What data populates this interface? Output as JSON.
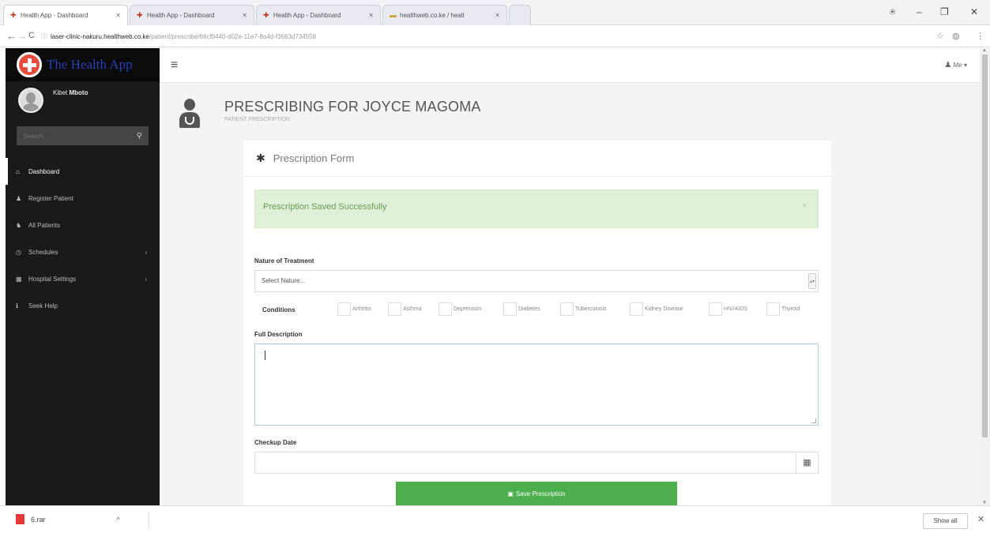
{
  "browser": {
    "tabs": [
      {
        "label": "Health App - Dashboard"
      },
      {
        "label": "Health App - Dashboard"
      },
      {
        "label": "Health App - Dashboard"
      },
      {
        "label": "healthweb.co.ke / healt"
      }
    ],
    "url_host": "laser-clinic-nakuru.healthweb.co.ke",
    "url_path": "/patient/prescribe/66cf8440-d02e-11e7-8a4d-f3663d734558",
    "nav": {
      "back": "←",
      "forward": "→",
      "reload": "C"
    },
    "window_controls": {
      "minimize": "–",
      "maximize": "❐",
      "close": "✕"
    }
  },
  "sidebar": {
    "brand": "The Health App",
    "user_first": "Kibet",
    "user_last": "Mboto",
    "search_placeholder": "Search...",
    "items": [
      {
        "label": "Dashboard",
        "icon": "home-icon",
        "glyph": "⌂"
      },
      {
        "label": "Register Patient",
        "icon": "user-icon",
        "glyph": "♟"
      },
      {
        "label": "All Patients",
        "icon": "users-icon",
        "glyph": "♞"
      },
      {
        "label": "Schedules",
        "icon": "clock-icon",
        "glyph": "◷"
      },
      {
        "label": "Hospital Settings",
        "icon": "building-icon",
        "glyph": "▦"
      },
      {
        "label": "Seek Help",
        "icon": "info-icon",
        "glyph": "ℹ"
      }
    ]
  },
  "topnav": {
    "me_label": "Me"
  },
  "page": {
    "title": "PRESCRIBING FOR JOYCE MAGOMA",
    "subtitle": "PATIENT PRESCRIPTION"
  },
  "form": {
    "panel_title": "Prescription Form",
    "alert": "Prescription Saved Successfully",
    "alert_close": "×",
    "nature_label": "Nature of Treatment",
    "nature_value": "Select Nature...",
    "conditions_label": "Conditions",
    "conditions": [
      "Arthritis",
      "Asthma",
      "Depression",
      "Diabetes",
      "Tuberculosis",
      "Kidney Disease",
      "HIV/AIDS",
      "Thyroid"
    ],
    "description_label": "Full Description",
    "description_value": "",
    "checkup_label": "Checkup Date",
    "checkup_value": "",
    "save_label": "Save Prescription"
  },
  "downloads": {
    "file_name": "6.rar",
    "show_all": "Show all",
    "close": "✕"
  }
}
